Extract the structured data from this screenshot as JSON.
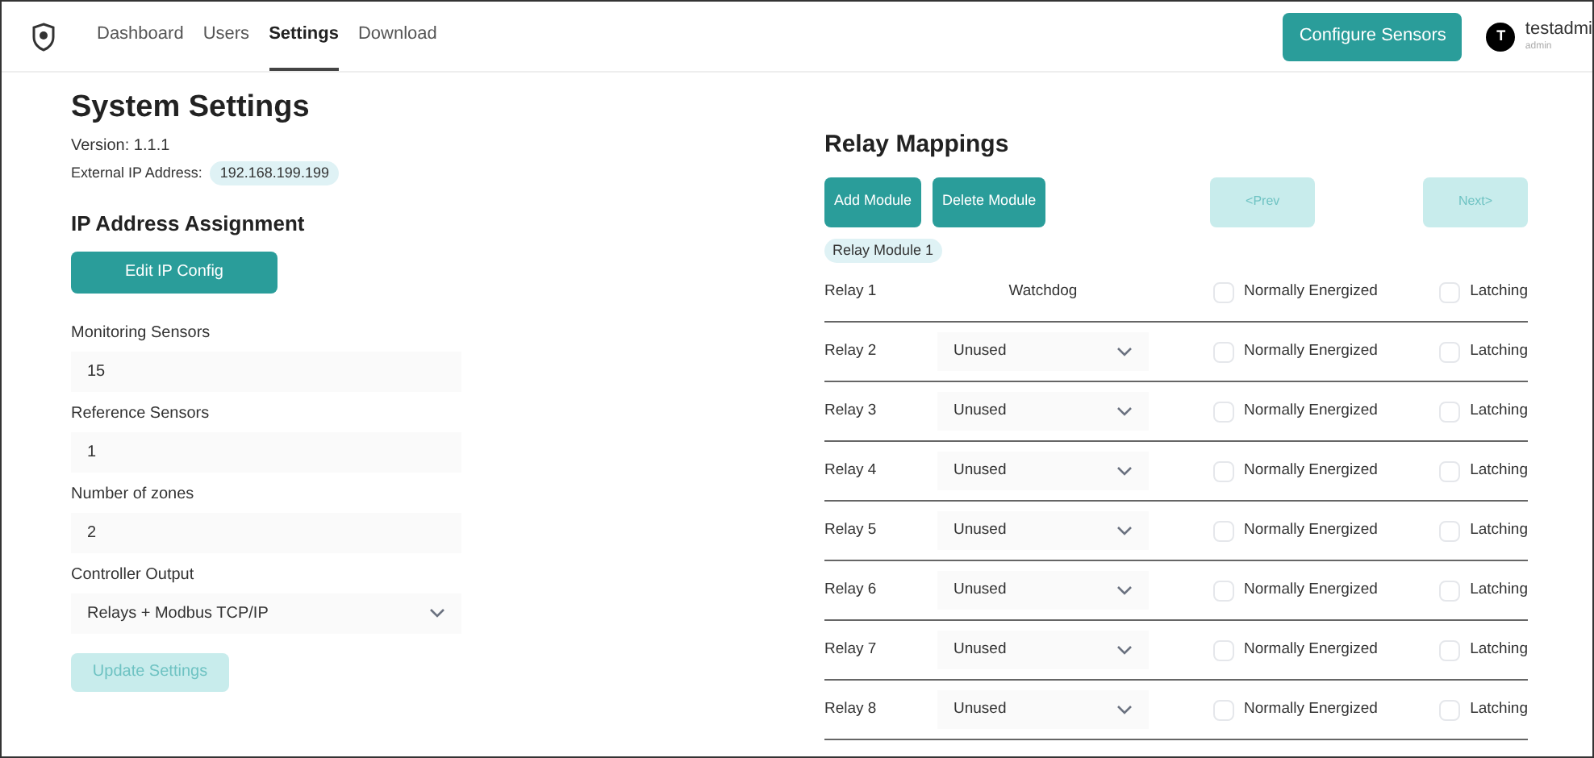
{
  "nav": {
    "tabs": [
      {
        "label": "Dashboard",
        "selected": false
      },
      {
        "label": "Users",
        "selected": false
      },
      {
        "label": "Settings",
        "selected": true
      },
      {
        "label": "Download",
        "selected": false
      }
    ],
    "configure_button": "Configure Sensors",
    "user": {
      "initial": "T",
      "name": "testadmi",
      "role": "admin"
    }
  },
  "system_settings": {
    "title": "System Settings",
    "version": "Version: 1.1.1",
    "ip_label": "External IP Address:",
    "ip_value": "192.168.199.199",
    "ip_assignment_title": "IP Address Assignment",
    "edit_ip_button": "Edit IP Config",
    "fields": [
      {
        "kind": "input",
        "label": "Monitoring Sensors",
        "value": "15"
      },
      {
        "kind": "input",
        "label": "Reference Sensors",
        "value": "1"
      },
      {
        "kind": "input",
        "label": "Number of zones",
        "value": "2"
      },
      {
        "kind": "select",
        "label": "Controller Output",
        "value": "Relays + Modbus TCP/IP"
      }
    ],
    "update_button": {
      "label": "Update Settings",
      "disabled": true
    }
  },
  "relay_mappings": {
    "title": "Relay Mappings",
    "buttons": [
      {
        "label": "Add Module",
        "disabled": false
      },
      {
        "label": "Delete Module",
        "disabled": false
      }
    ],
    "prev_button": {
      "label": "<Prev",
      "disabled": true
    },
    "next_button": {
      "label": "Next>",
      "disabled": true
    },
    "module_badge": "Relay Module 1",
    "relays": [
      {
        "name": "Relay 1",
        "kind": "fixed",
        "function": "Watchdog",
        "energized_label": "Normally Energized",
        "energized": false,
        "latching_label": "Latching",
        "latching": false
      },
      {
        "name": "Relay 2",
        "kind": "select",
        "function": "Unused",
        "energized_label": "Normally Energized",
        "energized": false,
        "latching_label": "Latching",
        "latching": false
      },
      {
        "name": "Relay 3",
        "kind": "select",
        "function": "Unused",
        "energized_label": "Normally Energized",
        "energized": false,
        "latching_label": "Latching",
        "latching": false
      },
      {
        "name": "Relay 4",
        "kind": "select",
        "function": "Unused",
        "energized_label": "Normally Energized",
        "energized": false,
        "latching_label": "Latching",
        "latching": false
      },
      {
        "name": "Relay 5",
        "kind": "select",
        "function": "Unused",
        "energized_label": "Normally Energized",
        "energized": false,
        "latching_label": "Latching",
        "latching": false
      },
      {
        "name": "Relay 6",
        "kind": "select",
        "function": "Unused",
        "energized_label": "Normally Energized",
        "energized": false,
        "latching_label": "Latching",
        "latching": false
      },
      {
        "name": "Relay 7",
        "kind": "select",
        "function": "Unused",
        "energized_label": "Normally Energized",
        "energized": false,
        "latching_label": "Latching",
        "latching": false
      },
      {
        "name": "Relay 8",
        "kind": "select",
        "function": "Unused",
        "energized_label": "Normally Energized",
        "energized": false,
        "latching_label": "Latching",
        "latching": false
      }
    ]
  }
}
